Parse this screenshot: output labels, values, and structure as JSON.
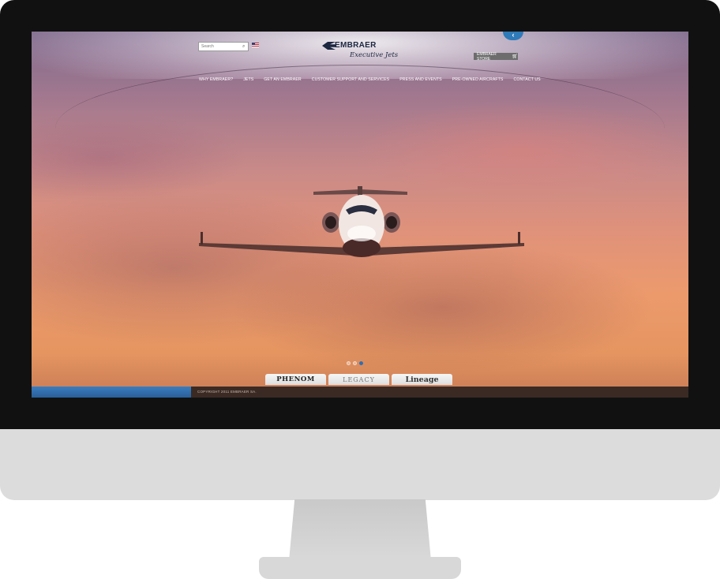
{
  "search": {
    "placeholder": "Search"
  },
  "logo": {
    "brand": "EMBRAER",
    "subtitle": "Executive Jets"
  },
  "store": {
    "label": "EMBRAER STORE"
  },
  "nav": {
    "items": [
      {
        "label": "WHY EMBRAER?"
      },
      {
        "label": "JETS"
      },
      {
        "label": "GET AN EMBRAER"
      },
      {
        "label": "CUSTOMER SUPPORT AND SERVICES"
      },
      {
        "label": "PRESS AND EVENTS"
      },
      {
        "label": "PRE-OWNED AIRCRAFTS"
      },
      {
        "label": "CONTACT US"
      }
    ]
  },
  "carousel": {
    "slide_count": 3,
    "active_index": 2
  },
  "jet_tabs": [
    {
      "label": "PHENOM"
    },
    {
      "label": "LEGACY"
    },
    {
      "label": "Lineage"
    }
  ],
  "footer": {
    "copyright": "COPYRIGHT 2011 EMBRAER SA."
  },
  "icons": {
    "search": "search-icon",
    "flag": "us-flag-icon",
    "cart": "cart-icon",
    "side_tab": "chevron-left-icon"
  },
  "colors": {
    "accent": "#2f7ab8",
    "brand_text": "#1c2740",
    "footer": "#3b2a24"
  }
}
